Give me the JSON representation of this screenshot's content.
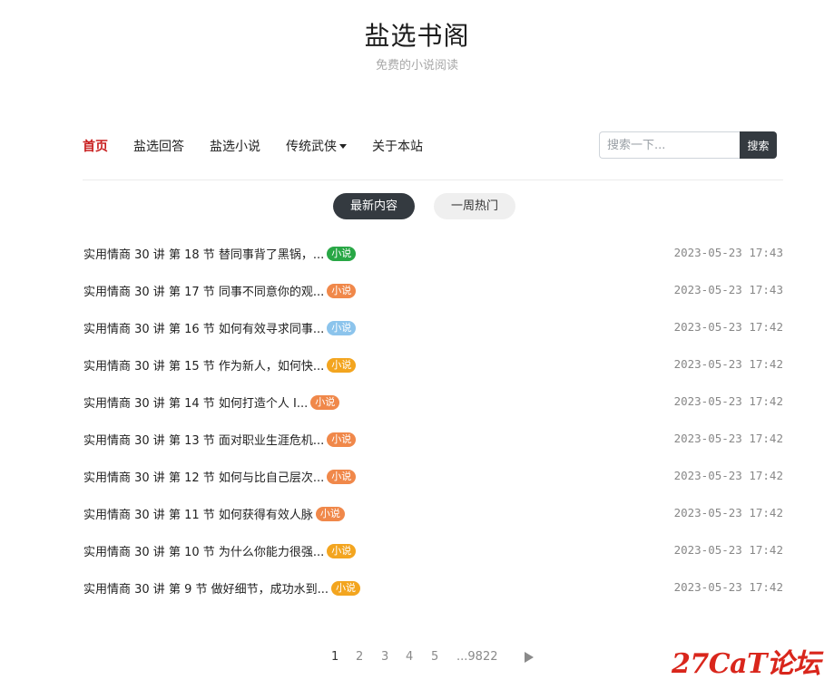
{
  "header": {
    "title": "盐选书阁",
    "subtitle": "免费的小说阅读"
  },
  "nav": {
    "items": [
      {
        "label": "首页",
        "active": true
      },
      {
        "label": "盐选回答",
        "active": false
      },
      {
        "label": "盐选小说",
        "active": false
      },
      {
        "label": "传统武侠",
        "active": false,
        "dropdown": true
      },
      {
        "label": "关于本站",
        "active": false
      }
    ],
    "search": {
      "placeholder": "搜索一下...",
      "value": "",
      "button_label": "搜索"
    }
  },
  "tabs": [
    {
      "label": "最新内容",
      "active": true
    },
    {
      "label": "一周热门",
      "active": false
    }
  ],
  "posts": [
    {
      "title": "实用情商 30 讲 第 18 节 替同事背了黑锅，...",
      "tag": "小说",
      "tag_color": "#28a745",
      "time": "2023-05-23 17:43"
    },
    {
      "title": "实用情商 30 讲 第 17 节 同事不同意你的观...",
      "tag": "小说",
      "tag_color": "#f0884a",
      "time": "2023-05-23 17:43"
    },
    {
      "title": "实用情商 30 讲 第 16 节 如何有效寻求同事...",
      "tag": "小说",
      "tag_color": "#8cc4ec",
      "time": "2023-05-23 17:42"
    },
    {
      "title": "实用情商 30 讲 第 15 节 作为新人，如何快...",
      "tag": "小说",
      "tag_color": "#f3a51f",
      "time": "2023-05-23 17:42"
    },
    {
      "title": "实用情商 30 讲 第 14 节 如何打造个人 I...",
      "tag": "小说",
      "tag_color": "#f0884a",
      "time": "2023-05-23 17:42"
    },
    {
      "title": "实用情商 30 讲 第 13 节 面对职业生涯危机...",
      "tag": "小说",
      "tag_color": "#f0884a",
      "time": "2023-05-23 17:42"
    },
    {
      "title": "实用情商 30 讲 第 12 节 如何与比自己层次...",
      "tag": "小说",
      "tag_color": "#f0884a",
      "time": "2023-05-23 17:42"
    },
    {
      "title": "实用情商 30 讲 第 11 节 如何获得有效人脉",
      "tag": "小说",
      "tag_color": "#f0884a",
      "time": "2023-05-23 17:42"
    },
    {
      "title": "实用情商 30 讲 第 10 节 为什么你能力很强...",
      "tag": "小说",
      "tag_color": "#f3a51f",
      "time": "2023-05-23 17:42"
    },
    {
      "title": "实用情商 30 讲 第 9 节 做好细节，成功水到...",
      "tag": "小说",
      "tag_color": "#f3a51f",
      "time": "2023-05-23 17:42"
    }
  ],
  "pagination": {
    "pages": [
      "1",
      "2",
      "3",
      "4",
      "5"
    ],
    "current": "1",
    "ellipsis_last": "...9822",
    "next_icon": "triangle-right-icon"
  },
  "watermark": "27CaT论坛",
  "colors": {
    "accent_red": "#c81e1e",
    "dark": "#343a40"
  }
}
